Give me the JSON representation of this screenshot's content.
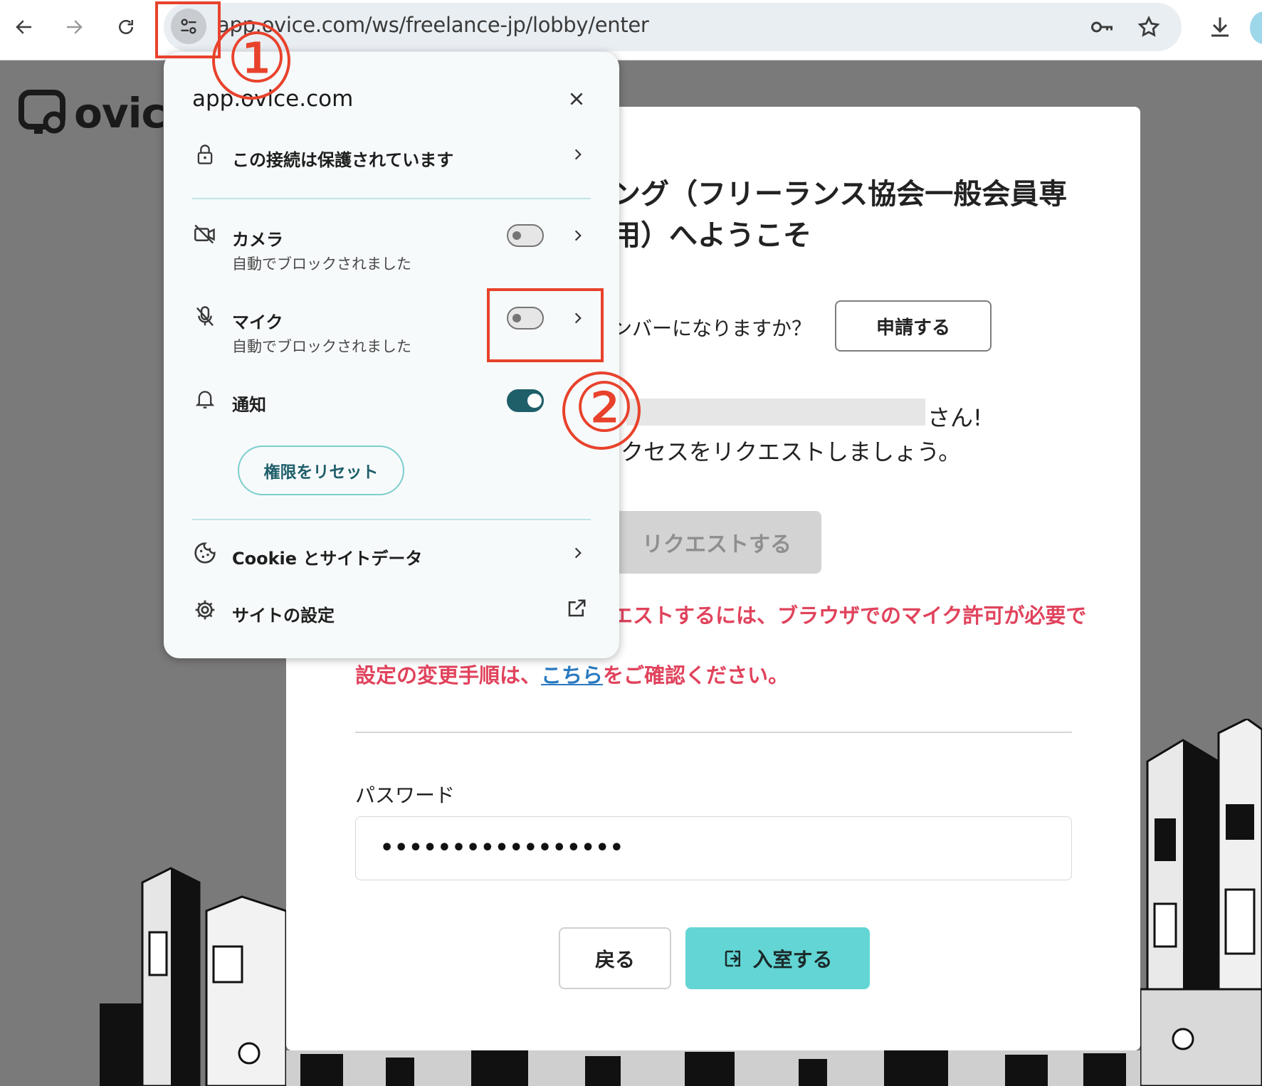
{
  "browser": {
    "url": "app.ovice.com/ws/freelance-jp/lobby/enter"
  },
  "logo": {
    "text": "ovic"
  },
  "card": {
    "welcome_line1": "ング（フリーランス協会一般会員専",
    "welcome_line2": "用）へようこそ",
    "member_question": "ンバーになりますか？",
    "apply_label": "申請する",
    "greeting_suffix": "さん!",
    "access_text": "クセスをリクエストしましょう。",
    "request_label": "リクエストする",
    "error_line1": "エストするには、ブラウザでのマイク許可が必要で",
    "error_line2_pre": "設定の変更手順は、",
    "error_link": "こちら",
    "error_line2_post": "をご確認ください。",
    "password_label": "パスワード",
    "password_value": "•••••••••••••••••",
    "back_label": "戻る",
    "enter_label": "入室する"
  },
  "popup": {
    "host": "app.ovice.com",
    "connection": "この接続は保護されています",
    "camera_label": "カメラ",
    "camera_status": "自動でブロックされました",
    "camera_enabled": false,
    "mic_label": "マイク",
    "mic_status": "自動でブロックされました",
    "mic_enabled": false,
    "notify_label": "通知",
    "notify_enabled": true,
    "reset_label": "権限をリセット",
    "cookie_label": "Cookie とサイトデータ",
    "site_settings_label": "サイトの設定"
  },
  "annotations": {
    "step1": "①",
    "step2": "②",
    "color": "#e8422c"
  },
  "colors": {
    "accent": "#63d5d5",
    "error": "#e0435c",
    "toggle_on": "#1f5f6a"
  }
}
